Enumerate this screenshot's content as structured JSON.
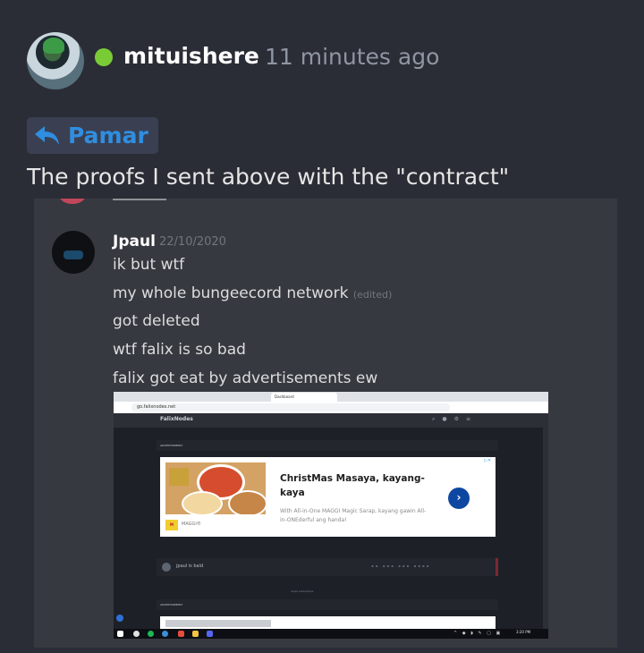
{
  "post": {
    "author": "mituishere",
    "time": "11 minutes ago",
    "reply_label": "Pamar",
    "message": "The proofs I sent above with the \"contract\""
  },
  "screenshot": {
    "author": "Jpaul",
    "date": "22/10/2020",
    "lines": [
      "ik but wtf",
      "my whole bungeecord network",
      "got deleted",
      "wtf falix is so bad",
      "falix got eat by advertisements ew"
    ],
    "edited_tag": "(edited)",
    "embedded": {
      "tabs": [
        "Dashboard"
      ],
      "url": "go.falixnodes.net",
      "app_title": "FalixNodes",
      "ad_section": "ADVERTISEMENT",
      "ad": {
        "title": "ChristMas Masaya, kayang-kaya",
        "subtitle": "With All-in-One MAGGI Magic Sarap, kayang gawin All-in-ONEderful ang handa!",
        "brand": "MAGGI®"
      },
      "server_row": "jpaul is bald",
      "taskbar_time": "3:20 PM"
    }
  },
  "colors": {
    "background": "#2b2d36",
    "online": "#7acc36",
    "reply_accent": "#2f8ee0"
  },
  "icons": [
    "reply-arrow-icon",
    "online-status-icon"
  ]
}
